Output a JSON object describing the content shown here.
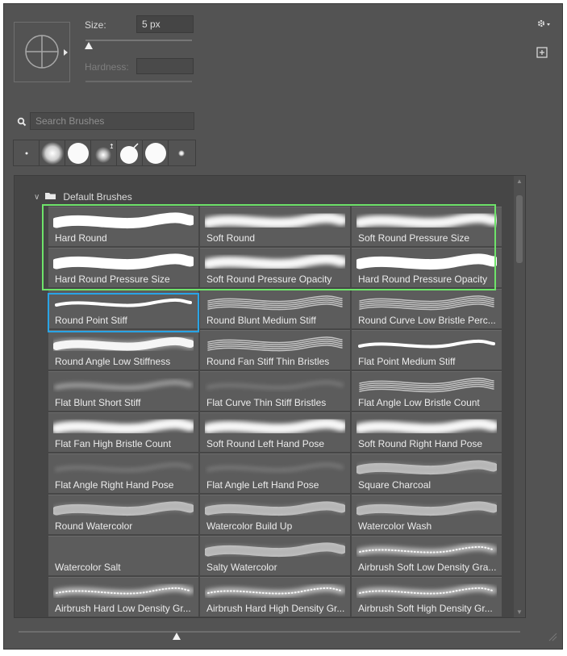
{
  "brush_settings": {
    "size_label": "Size:",
    "size_value": "5 px",
    "size_fraction": 0.03,
    "hardness_label": "Hardness:",
    "hardness_value": ""
  },
  "search": {
    "placeholder": "Search Brushes"
  },
  "recent_brushes": [
    "hard-dot",
    "soft-large",
    "hard-large",
    "soft-pressure",
    "hard-pressure",
    "hard-large-2",
    "soft-small"
  ],
  "folder": {
    "name": "Default Brushes",
    "expanded": true
  },
  "brushes": [
    {
      "name": "Hard Round",
      "stroke": "hard"
    },
    {
      "name": "Soft Round",
      "stroke": "soft"
    },
    {
      "name": "Soft Round Pressure Size",
      "stroke": "soft"
    },
    {
      "name": "Hard Round Pressure Size",
      "stroke": "hard"
    },
    {
      "name": "Soft Round Pressure Opacity",
      "stroke": "soft"
    },
    {
      "name": "Hard Round Pressure Opacity",
      "stroke": "hard"
    },
    {
      "name": "Round Point Stiff",
      "stroke": "thin"
    },
    {
      "name": "Round Blunt Medium Stiff",
      "stroke": "bristle"
    },
    {
      "name": "Round Curve Low Bristle Perc...",
      "stroke": "bristle"
    },
    {
      "name": "Round Angle Low Stiffness",
      "stroke": "wedge"
    },
    {
      "name": "Round Fan Stiff Thin Bristles",
      "stroke": "bristle"
    },
    {
      "name": "Flat Point Medium Stiff",
      "stroke": "thin"
    },
    {
      "name": "Flat Blunt Short Stiff",
      "stroke": "fade"
    },
    {
      "name": "Flat Curve Thin Stiff Bristles",
      "stroke": "faint"
    },
    {
      "name": "Flat Angle Low Bristle Count",
      "stroke": "bristle"
    },
    {
      "name": "Flat Fan High Bristle Count",
      "stroke": "soft"
    },
    {
      "name": "Soft Round Left Hand Pose",
      "stroke": "soft"
    },
    {
      "name": "Soft Round Right Hand Pose",
      "stroke": "soft"
    },
    {
      "name": "Flat Angle Right Hand Pose",
      "stroke": "faint"
    },
    {
      "name": "Flat Angle Left Hand Pose",
      "stroke": "faint"
    },
    {
      "name": "Square Charcoal",
      "stroke": "texture"
    },
    {
      "name": "Round Watercolor",
      "stroke": "texture"
    },
    {
      "name": "Watercolor Build Up",
      "stroke": "texture"
    },
    {
      "name": "Watercolor Wash",
      "stroke": "texture"
    },
    {
      "name": "Watercolor Salt",
      "stroke": "none"
    },
    {
      "name": "Salty Watercolor",
      "stroke": "texture"
    },
    {
      "name": "Airbrush Soft Low Density Gra...",
      "stroke": "spray"
    },
    {
      "name": "Airbrush Hard Low Density Gr...",
      "stroke": "spray"
    },
    {
      "name": "Airbrush Hard High Density Gr...",
      "stroke": "spray"
    },
    {
      "name": "Airbrush Soft High Density Gr...",
      "stroke": "spray"
    }
  ],
  "selection": {
    "green_group": [
      "Hard Round",
      "Soft Round",
      "Soft Round Pressure Size",
      "Hard Round Pressure Size",
      "Soft Round Pressure Opacity",
      "Hard Round Pressure Opacity"
    ],
    "blue_item": "Round Point Stiff"
  },
  "colors": {
    "panel": "#535353",
    "green_outline": "#6ee36a",
    "blue_outline": "#29a4e6"
  },
  "icons": {
    "settings": "gear-icon",
    "new_brush": "new-brush-icon",
    "search": "search-icon",
    "folder": "folder-icon"
  }
}
